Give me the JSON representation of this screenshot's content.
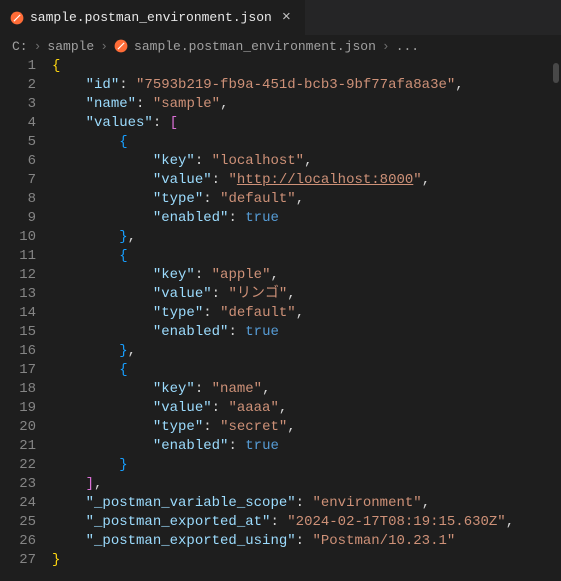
{
  "tab": {
    "label": "sample.postman_environment.json",
    "modified": true
  },
  "breadcrumb": {
    "drive": "C:",
    "folder": "sample",
    "file": "sample.postman_environment.json",
    "tail": "..."
  },
  "json": {
    "id_key": "\"id\"",
    "id_val": "\"7593b219-fb9a-451d-bcb3-9bf77afa8a3e\"",
    "name_key": "\"name\"",
    "name_val": "\"sample\"",
    "values_key": "\"values\"",
    "v0": {
      "key_key": "\"key\"",
      "key_val": "\"localhost\"",
      "value_key": "\"value\"",
      "value_val_pre": "\"",
      "value_url": "http://localhost:8000",
      "value_val_post": "\"",
      "type_key": "\"type\"",
      "type_val": "\"default\"",
      "enabled_key": "\"enabled\"",
      "enabled_val": "true"
    },
    "v1": {
      "key_key": "\"key\"",
      "key_val": "\"apple\"",
      "value_key": "\"value\"",
      "value_val": "\"リンゴ\"",
      "type_key": "\"type\"",
      "type_val": "\"default\"",
      "enabled_key": "\"enabled\"",
      "enabled_val": "true"
    },
    "v2": {
      "key_key": "\"key\"",
      "key_val": "\"name\"",
      "value_key": "\"value\"",
      "value_val": "\"aaaa\"",
      "type_key": "\"type\"",
      "type_val": "\"secret\"",
      "enabled_key": "\"enabled\"",
      "enabled_val": "true"
    },
    "scope_key": "\"_postman_variable_scope\"",
    "scope_val": "\"environment\"",
    "exported_at_key": "\"_postman_exported_at\"",
    "exported_at_val": "\"2024-02-17T08:19:15.630Z\"",
    "exported_using_key": "\"_postman_exported_using\"",
    "exported_using_val": "\"Postman/10.23.1\""
  },
  "icon_colors": {
    "postman": "#ff6c37"
  }
}
